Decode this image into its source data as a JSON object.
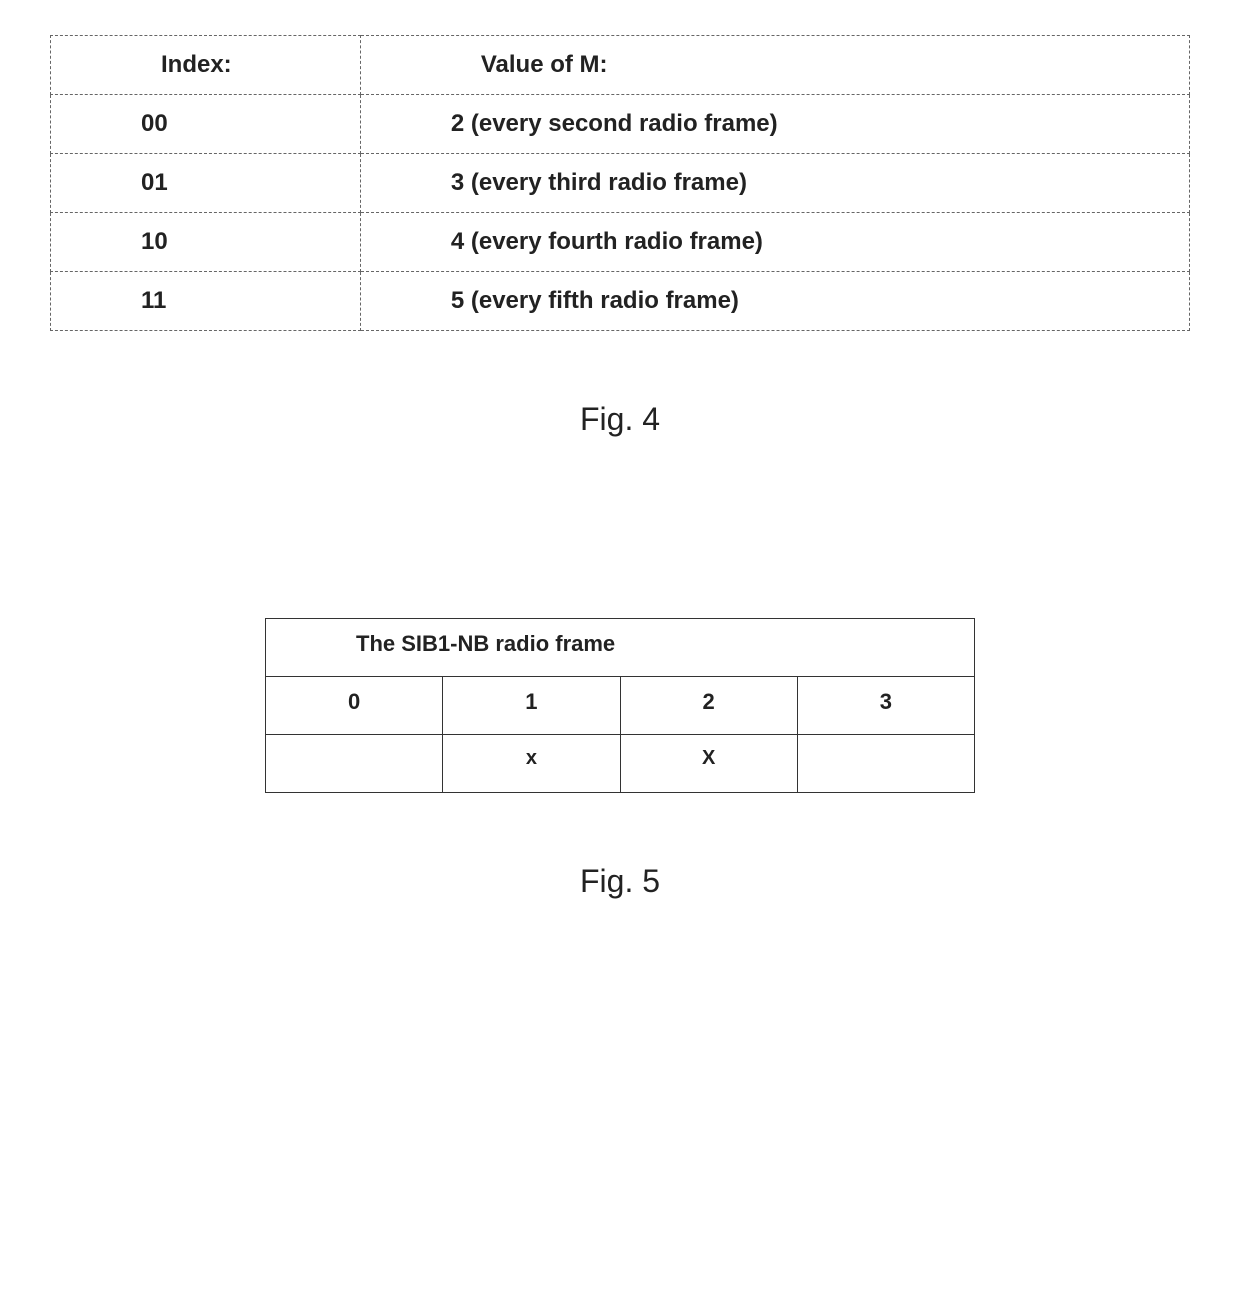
{
  "chart_data": [
    {
      "type": "table",
      "title": "Fig. 4",
      "columns": [
        "Index:",
        "Value of M:"
      ],
      "rows": [
        [
          "00",
          "2 (every second radio frame)"
        ],
        [
          "01",
          "3 (every third radio frame)"
        ],
        [
          "10",
          "4 (every fourth radio frame)"
        ],
        [
          "11",
          "5 (every fifth radio frame)"
        ]
      ]
    },
    {
      "type": "table",
      "title": "Fig. 5",
      "header": "The SIB1-NB radio frame",
      "columns": [
        "0",
        "1",
        "2",
        "3"
      ],
      "rows": [
        [
          "",
          "x",
          "X",
          ""
        ]
      ]
    }
  ],
  "table1": {
    "head_index": "Index:",
    "head_value": "Value of M:",
    "r0_index": "00",
    "r0_value": "2 (every second radio frame)",
    "r1_index": "01",
    "r1_value": "3 (every third radio frame)",
    "r2_index": "10",
    "r2_value": "4 (every fourth radio frame)",
    "r3_index": "11",
    "r3_value": "5 (every fifth radio frame)"
  },
  "fig4_caption": "Fig. 4",
  "table2": {
    "header": "The SIB1-NB radio frame",
    "c0": "0",
    "c1": "1",
    "c2": "2",
    "c3": "3",
    "x0": "",
    "x1": "x",
    "x2": "X",
    "x3": ""
  },
  "fig5_caption": "Fig. 5"
}
